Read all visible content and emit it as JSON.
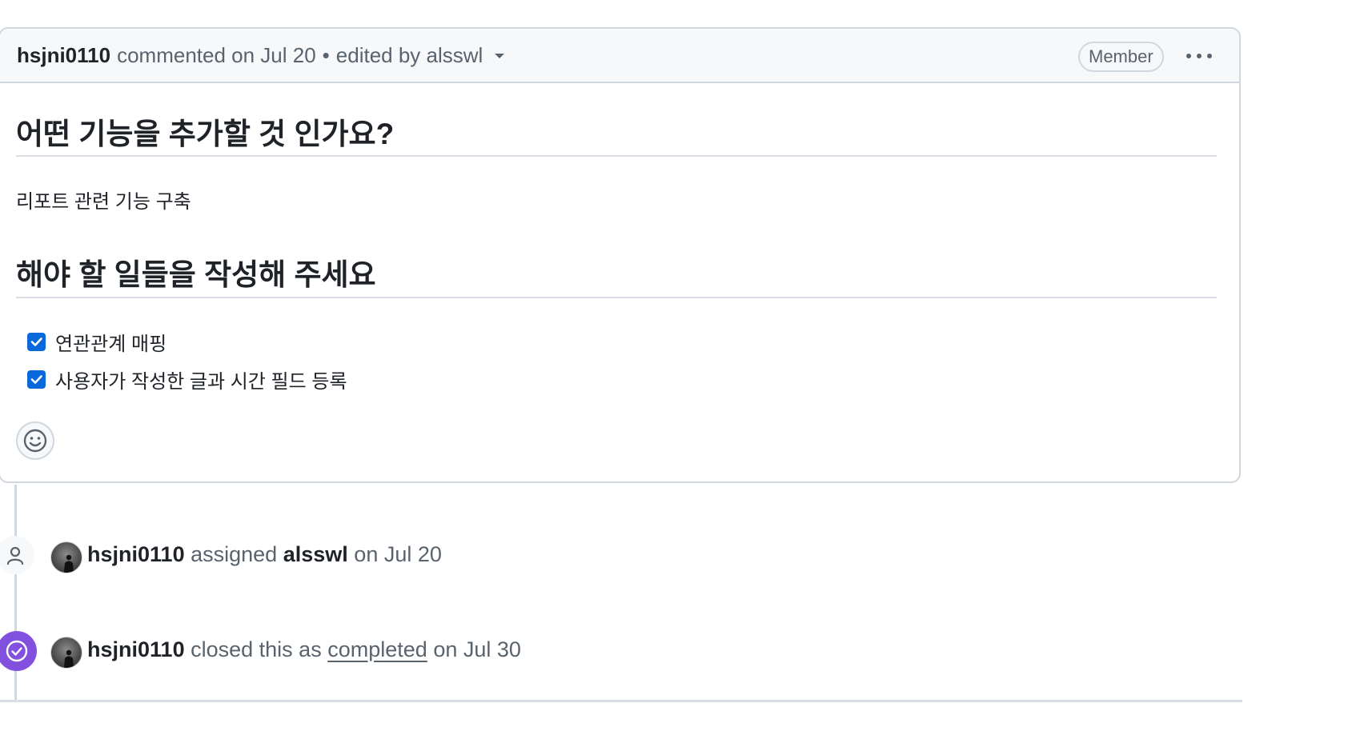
{
  "comment": {
    "author": "hsjni0110",
    "action": "commented on Jul 20",
    "separator": "•",
    "edited": "edited by alsswl",
    "badge": "Member",
    "body": {
      "heading1": "어떤 기능을 추가할 것 인가요?",
      "paragraph": "리포트 관련 기능 구축",
      "heading2": "해야 할 일들을 작성해 주세요",
      "tasks": [
        {
          "label": "연관관계 매핑",
          "checked": true
        },
        {
          "label": "사용자가 작성한 글과 시간 필드 등록",
          "checked": true
        }
      ]
    }
  },
  "timeline": [
    {
      "icon": "person-icon",
      "actor": "hsjni0110",
      "verb": "assigned",
      "target": "alsswl",
      "date": "on Jul 20"
    },
    {
      "icon": "check-circle-icon",
      "actor": "hsjni0110",
      "verb": "closed this as",
      "link": "completed",
      "date": "on Jul 30"
    }
  ],
  "colors": {
    "checkbox": "#0969da",
    "closed_badge": "#8250df",
    "border": "#d0d7de"
  }
}
